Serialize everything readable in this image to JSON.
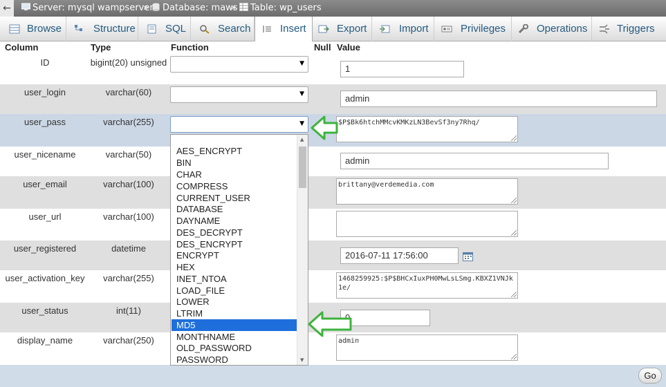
{
  "breadcrumb": {
    "server_label": "Server: mysql wampserver",
    "database_label": "Database: maws",
    "table_label": "Table: wp_users",
    "separator": "»",
    "back_glyph": "←"
  },
  "tabs": [
    {
      "label": "Browse",
      "icon": "browse-icon"
    },
    {
      "label": "Structure",
      "icon": "structure-icon"
    },
    {
      "label": "SQL",
      "icon": "sql-icon"
    },
    {
      "label": "Search",
      "icon": "search-icon"
    },
    {
      "label": "Insert",
      "icon": "insert-icon",
      "active": true
    },
    {
      "label": "Export",
      "icon": "export-icon"
    },
    {
      "label": "Import",
      "icon": "import-icon"
    },
    {
      "label": "Privileges",
      "icon": "privileges-icon"
    },
    {
      "label": "Operations",
      "icon": "operations-icon"
    },
    {
      "label": "Triggers",
      "icon": "triggers-icon"
    }
  ],
  "columns_header": {
    "column": "Column",
    "type": "Type",
    "function": "Function",
    "null": "Null",
    "value": "Value"
  },
  "rows": [
    {
      "name": "ID",
      "type": "bigint(20) unsigned",
      "value": "1"
    },
    {
      "name": "user_login",
      "type": "varchar(60)",
      "value": "admin"
    },
    {
      "name": "user_pass",
      "type": "varchar(255)",
      "value": "$P$Bk6htchMMcvKMKzLN3BevSf3ny7Rhq/"
    },
    {
      "name": "user_nicename",
      "type": "varchar(50)",
      "value": "admin"
    },
    {
      "name": "user_email",
      "type": "varchar(100)",
      "value": "brittany@verdemedia.com"
    },
    {
      "name": "user_url",
      "type": "varchar(100)",
      "value": ""
    },
    {
      "name": "user_registered",
      "type": "datetime",
      "value": "2016-07-11 17:56:00"
    },
    {
      "name": "user_activation_key",
      "type": "varchar(255)",
      "value": "1468259925:$P$BHCxIuxPH0MwLsLSmg.KBXZ1VNJk1e/"
    },
    {
      "name": "user_status",
      "type": "int(11)",
      "value": "0"
    },
    {
      "name": "display_name",
      "type": "varchar(250)",
      "value": "admin"
    }
  ],
  "function_options": [
    "AES_ENCRYPT",
    "BIN",
    "CHAR",
    "COMPRESS",
    "CURRENT_USER",
    "DATABASE",
    "DAYNAME",
    "DES_DECRYPT",
    "DES_ENCRYPT",
    "ENCRYPT",
    "HEX",
    "INET_NTOA",
    "LOAD_FILE",
    "LOWER",
    "LTRIM",
    "MD5",
    "MONTHNAME",
    "OLD_PASSWORD",
    "PASSWORD"
  ],
  "selected_function": "MD5",
  "go_label": "Go",
  "colors": {
    "tab_text": "#235a81",
    "selected_option": "#1e6fdc",
    "annotation_arrow": "#3db33d"
  }
}
